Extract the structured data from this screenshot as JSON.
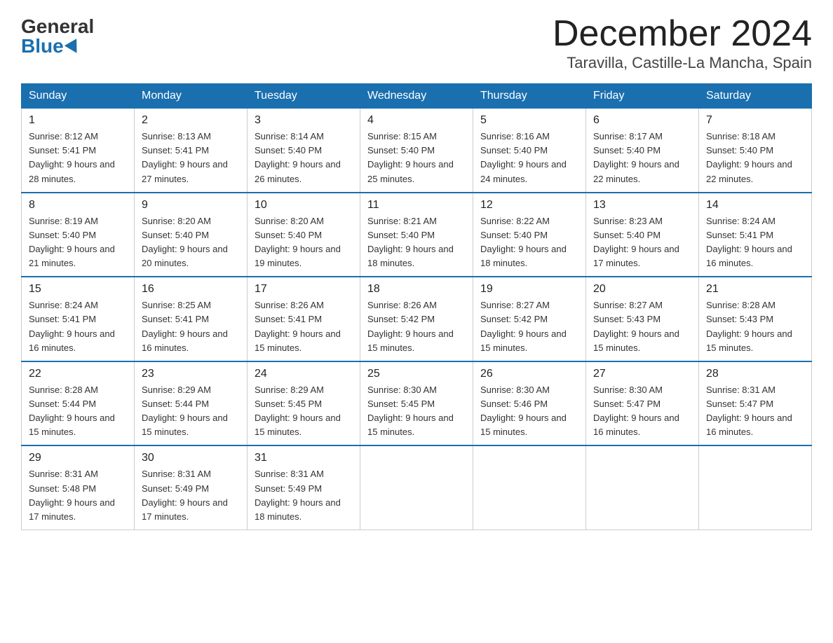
{
  "header": {
    "logo_general": "General",
    "logo_blue": "Blue",
    "month_title": "December 2024",
    "location": "Taravilla, Castille-La Mancha, Spain"
  },
  "columns": [
    "Sunday",
    "Monday",
    "Tuesday",
    "Wednesday",
    "Thursday",
    "Friday",
    "Saturday"
  ],
  "weeks": [
    [
      {
        "day": "1",
        "sunrise": "Sunrise: 8:12 AM",
        "sunset": "Sunset: 5:41 PM",
        "daylight": "Daylight: 9 hours and 28 minutes."
      },
      {
        "day": "2",
        "sunrise": "Sunrise: 8:13 AM",
        "sunset": "Sunset: 5:41 PM",
        "daylight": "Daylight: 9 hours and 27 minutes."
      },
      {
        "day": "3",
        "sunrise": "Sunrise: 8:14 AM",
        "sunset": "Sunset: 5:40 PM",
        "daylight": "Daylight: 9 hours and 26 minutes."
      },
      {
        "day": "4",
        "sunrise": "Sunrise: 8:15 AM",
        "sunset": "Sunset: 5:40 PM",
        "daylight": "Daylight: 9 hours and 25 minutes."
      },
      {
        "day": "5",
        "sunrise": "Sunrise: 8:16 AM",
        "sunset": "Sunset: 5:40 PM",
        "daylight": "Daylight: 9 hours and 24 minutes."
      },
      {
        "day": "6",
        "sunrise": "Sunrise: 8:17 AM",
        "sunset": "Sunset: 5:40 PM",
        "daylight": "Daylight: 9 hours and 22 minutes."
      },
      {
        "day": "7",
        "sunrise": "Sunrise: 8:18 AM",
        "sunset": "Sunset: 5:40 PM",
        "daylight": "Daylight: 9 hours and 22 minutes."
      }
    ],
    [
      {
        "day": "8",
        "sunrise": "Sunrise: 8:19 AM",
        "sunset": "Sunset: 5:40 PM",
        "daylight": "Daylight: 9 hours and 21 minutes."
      },
      {
        "day": "9",
        "sunrise": "Sunrise: 8:20 AM",
        "sunset": "Sunset: 5:40 PM",
        "daylight": "Daylight: 9 hours and 20 minutes."
      },
      {
        "day": "10",
        "sunrise": "Sunrise: 8:20 AM",
        "sunset": "Sunset: 5:40 PM",
        "daylight": "Daylight: 9 hours and 19 minutes."
      },
      {
        "day": "11",
        "sunrise": "Sunrise: 8:21 AM",
        "sunset": "Sunset: 5:40 PM",
        "daylight": "Daylight: 9 hours and 18 minutes."
      },
      {
        "day": "12",
        "sunrise": "Sunrise: 8:22 AM",
        "sunset": "Sunset: 5:40 PM",
        "daylight": "Daylight: 9 hours and 18 minutes."
      },
      {
        "day": "13",
        "sunrise": "Sunrise: 8:23 AM",
        "sunset": "Sunset: 5:40 PM",
        "daylight": "Daylight: 9 hours and 17 minutes."
      },
      {
        "day": "14",
        "sunrise": "Sunrise: 8:24 AM",
        "sunset": "Sunset: 5:41 PM",
        "daylight": "Daylight: 9 hours and 16 minutes."
      }
    ],
    [
      {
        "day": "15",
        "sunrise": "Sunrise: 8:24 AM",
        "sunset": "Sunset: 5:41 PM",
        "daylight": "Daylight: 9 hours and 16 minutes."
      },
      {
        "day": "16",
        "sunrise": "Sunrise: 8:25 AM",
        "sunset": "Sunset: 5:41 PM",
        "daylight": "Daylight: 9 hours and 16 minutes."
      },
      {
        "day": "17",
        "sunrise": "Sunrise: 8:26 AM",
        "sunset": "Sunset: 5:41 PM",
        "daylight": "Daylight: 9 hours and 15 minutes."
      },
      {
        "day": "18",
        "sunrise": "Sunrise: 8:26 AM",
        "sunset": "Sunset: 5:42 PM",
        "daylight": "Daylight: 9 hours and 15 minutes."
      },
      {
        "day": "19",
        "sunrise": "Sunrise: 8:27 AM",
        "sunset": "Sunset: 5:42 PM",
        "daylight": "Daylight: 9 hours and 15 minutes."
      },
      {
        "day": "20",
        "sunrise": "Sunrise: 8:27 AM",
        "sunset": "Sunset: 5:43 PM",
        "daylight": "Daylight: 9 hours and 15 minutes."
      },
      {
        "day": "21",
        "sunrise": "Sunrise: 8:28 AM",
        "sunset": "Sunset: 5:43 PM",
        "daylight": "Daylight: 9 hours and 15 minutes."
      }
    ],
    [
      {
        "day": "22",
        "sunrise": "Sunrise: 8:28 AM",
        "sunset": "Sunset: 5:44 PM",
        "daylight": "Daylight: 9 hours and 15 minutes."
      },
      {
        "day": "23",
        "sunrise": "Sunrise: 8:29 AM",
        "sunset": "Sunset: 5:44 PM",
        "daylight": "Daylight: 9 hours and 15 minutes."
      },
      {
        "day": "24",
        "sunrise": "Sunrise: 8:29 AM",
        "sunset": "Sunset: 5:45 PM",
        "daylight": "Daylight: 9 hours and 15 minutes."
      },
      {
        "day": "25",
        "sunrise": "Sunrise: 8:30 AM",
        "sunset": "Sunset: 5:45 PM",
        "daylight": "Daylight: 9 hours and 15 minutes."
      },
      {
        "day": "26",
        "sunrise": "Sunrise: 8:30 AM",
        "sunset": "Sunset: 5:46 PM",
        "daylight": "Daylight: 9 hours and 15 minutes."
      },
      {
        "day": "27",
        "sunrise": "Sunrise: 8:30 AM",
        "sunset": "Sunset: 5:47 PM",
        "daylight": "Daylight: 9 hours and 16 minutes."
      },
      {
        "day": "28",
        "sunrise": "Sunrise: 8:31 AM",
        "sunset": "Sunset: 5:47 PM",
        "daylight": "Daylight: 9 hours and 16 minutes."
      }
    ],
    [
      {
        "day": "29",
        "sunrise": "Sunrise: 8:31 AM",
        "sunset": "Sunset: 5:48 PM",
        "daylight": "Daylight: 9 hours and 17 minutes."
      },
      {
        "day": "30",
        "sunrise": "Sunrise: 8:31 AM",
        "sunset": "Sunset: 5:49 PM",
        "daylight": "Daylight: 9 hours and 17 minutes."
      },
      {
        "day": "31",
        "sunrise": "Sunrise: 8:31 AM",
        "sunset": "Sunset: 5:49 PM",
        "daylight": "Daylight: 9 hours and 18 minutes."
      },
      null,
      null,
      null,
      null
    ]
  ]
}
